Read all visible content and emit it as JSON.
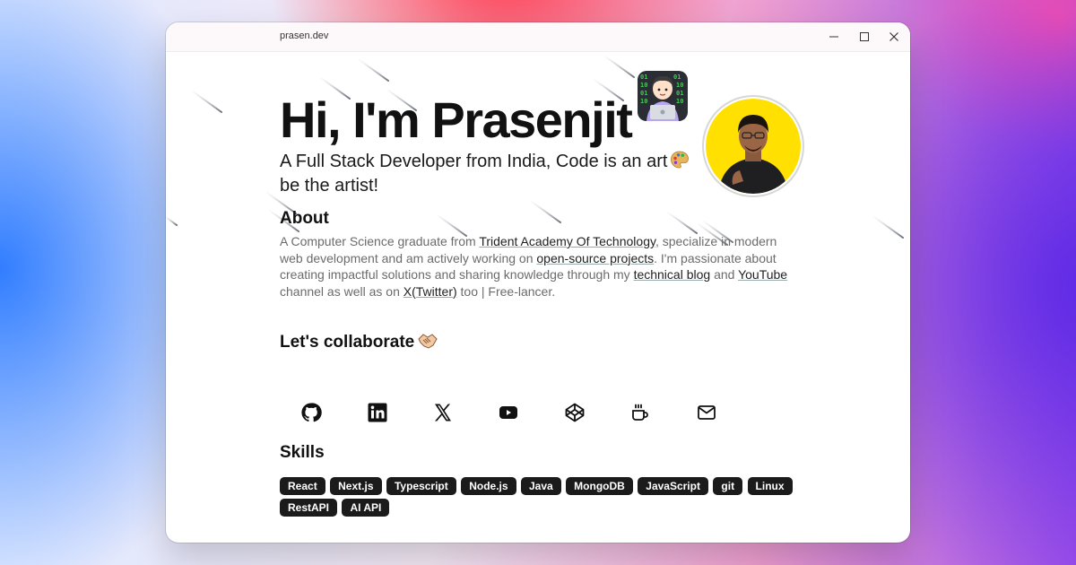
{
  "window": {
    "title": "prasen.dev"
  },
  "hero": {
    "heading": "Hi, I'm Prasenjit",
    "subtitle": "A Full Stack Developer from India, Code is an art",
    "subtitle_end": "be the artist!",
    "emoji_name": "technologist-emoji",
    "palette_emoji_name": "palette-emoji"
  },
  "about": {
    "title": "About",
    "t1": "A Computer Science graduate from ",
    "link_college": "Trident Academy Of Technology",
    "t2": ", specialize in modern web development and am actively working on ",
    "link_oss": "open-source projects",
    "t3": ". I'm passionate about creating impactful solutions and sharing knowledge through my ",
    "link_blog": "technical blog",
    "t4": " and ",
    "link_youtube": "YouTube",
    "t5": " channel as well as on ",
    "link_twitter": "X(Twitter)",
    "t6": " too | Free-lancer."
  },
  "collaborate": {
    "title": "Let's collaborate",
    "emoji_name": "handshake-emoji",
    "socials": [
      "github-icon",
      "linkedin-icon",
      "x-icon",
      "youtube-icon",
      "codepen-icon",
      "coffee-icon",
      "mail-icon"
    ]
  },
  "skills": {
    "title": "Skills",
    "items": [
      "React",
      "Next.js",
      "Typescript",
      "Node.js",
      "Java",
      "MongoDB",
      "JavaScript",
      "git",
      "Linux",
      "RestAPI",
      "AI API"
    ]
  },
  "colors": {
    "text": "#111111",
    "muted": "#6b6b6b",
    "tag_bg": "#1b1b1b",
    "avatar_bg": "#ffe000"
  }
}
